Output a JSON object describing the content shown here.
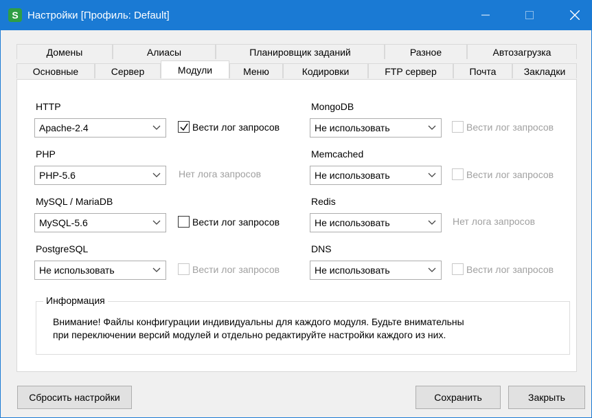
{
  "window": {
    "icon_letter": "S",
    "title": "Настройки [Профиль: Default]"
  },
  "tabs_row1": [
    "Домены",
    "Алиасы",
    "Планировщик заданий",
    "Разное",
    "Автозагрузка"
  ],
  "tabs_row2": [
    "Основные",
    "Сервер",
    "Модули",
    "Меню",
    "Кодировки",
    "FTP сервер",
    "Почта",
    "Закладки"
  ],
  "active_tab": "Модули",
  "modules": {
    "http": {
      "label": "HTTP",
      "value": "Apache-2.4",
      "log_label": "Вести лог запросов",
      "log_checked": true,
      "log_enabled": true
    },
    "php": {
      "label": "PHP",
      "value": "PHP-5.6",
      "nolog": "Нет лога запросов"
    },
    "mysql": {
      "label": "MySQL / MariaDB",
      "value": "MySQL-5.6",
      "log_label": "Вести лог запросов",
      "log_checked": false,
      "log_enabled": true
    },
    "postgresql": {
      "label": "PostgreSQL",
      "value": "Не использовать",
      "log_label": "Вести лог запросов",
      "log_checked": false,
      "log_enabled": false
    },
    "mongodb": {
      "label": "MongoDB",
      "value": "Не использовать",
      "log_label": "Вести лог запросов",
      "log_checked": false,
      "log_enabled": false
    },
    "memcached": {
      "label": "Memcached",
      "value": "Не использовать",
      "log_label": "Вести лог запросов",
      "log_checked": false,
      "log_enabled": false
    },
    "redis": {
      "label": "Redis",
      "value": "Не использовать",
      "nolog": "Нет лога запросов"
    },
    "dns": {
      "label": "DNS",
      "value": "Не использовать",
      "log_label": "Вести лог запросов",
      "log_checked": false,
      "log_enabled": false
    }
  },
  "info": {
    "legend": "Информация",
    "line1": "Внимание! Файлы конфигурации индивидуальны для каждого модуля. Будьте внимательны",
    "line2": "при переключении версий модулей и отдельно редактируйте настройки каждого из них."
  },
  "buttons": {
    "reset": "Сбросить настройки",
    "save": "Сохранить",
    "close": "Закрыть"
  },
  "icons": {
    "minimize": "minimize-icon",
    "maximize": "maximize-icon",
    "close": "close-icon",
    "dropdown": "chevron-down-icon",
    "check": "checkmark-icon"
  },
  "colors": {
    "titlebar": "#1a7ad4",
    "app_icon": "#2f9e44"
  }
}
